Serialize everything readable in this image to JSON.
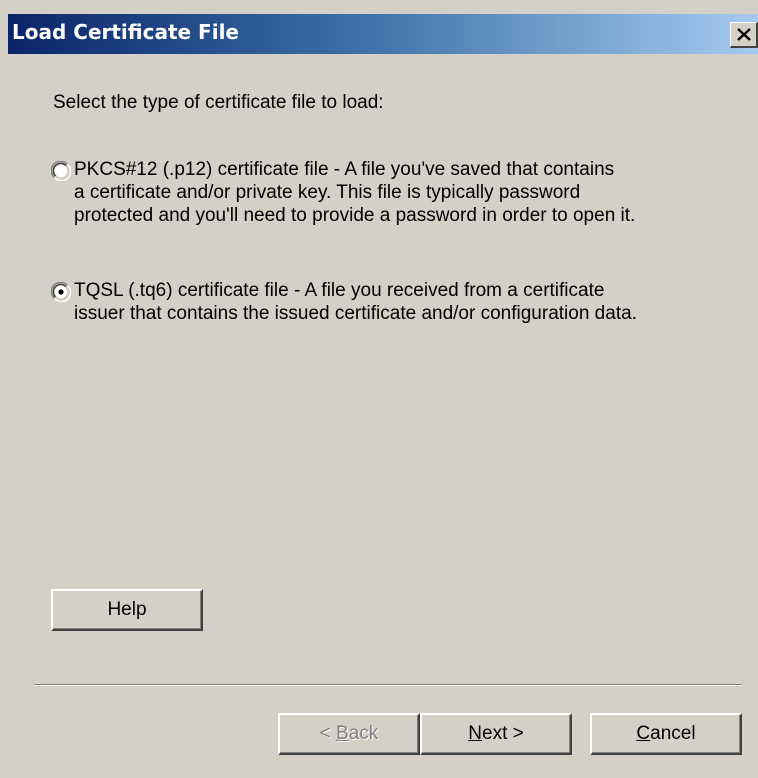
{
  "window": {
    "title": "Load Certificate File"
  },
  "prompt": "Select the type of certificate file to load:",
  "options": [
    {
      "selected": false,
      "lines": [
        "PKCS#12 (.p12) certificate file - A file you've saved that contains",
        "a certificate and/or private key. This file is typically password",
        "protected and you'll need to provide a password in order to open it."
      ]
    },
    {
      "selected": true,
      "lines": [
        "TQSL (.tq6) certificate file - A file you received from a certificate",
        "issuer that contains the issued certificate and/or configuration data."
      ]
    }
  ],
  "buttons": {
    "help": "Help",
    "back_prefix": "< ",
    "back_accel": "B",
    "back_rest": "ack",
    "next_accel": "N",
    "next_rest": "ext >",
    "cancel_accel": "C",
    "cancel_rest": "ancel"
  },
  "colors": {
    "dialog_bg": "#d4d0c8",
    "titlebar_start": "#0a246a",
    "titlebar_end": "#a6caf0",
    "disabled_text": "#808080"
  }
}
